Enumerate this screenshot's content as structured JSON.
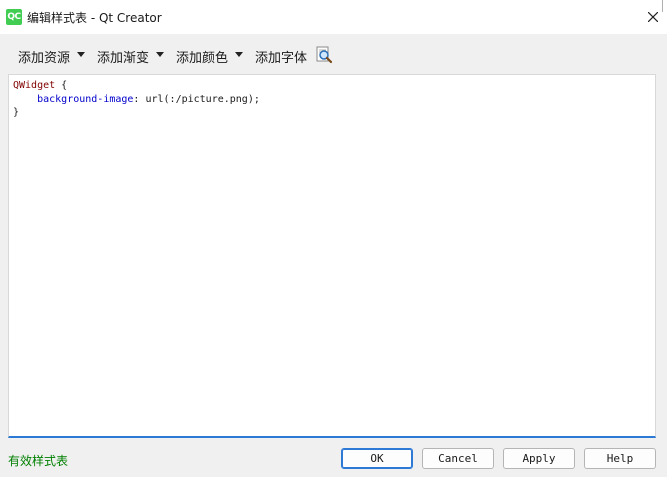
{
  "window": {
    "title": "编辑样式表 - Qt Creator",
    "app_icon_text": "QC"
  },
  "toolbar": {
    "add_resource": "添加资源",
    "add_gradient": "添加渐变",
    "add_color": "添加颜色",
    "add_font": "添加字体"
  },
  "editor": {
    "line1_selector": "QWidget",
    "line1_brace": " {",
    "line2_indent": "    ",
    "line2_property": "background-image",
    "line2_sep": ": ",
    "line2_value": "url(:/picture.png);",
    "line3_brace": "}"
  },
  "status": {
    "text": "有效样式表"
  },
  "buttons": {
    "ok": "OK",
    "cancel": "Cancel",
    "apply": "Apply",
    "help": "Help"
  },
  "colors": {
    "accent": "#2d7ad6",
    "status_valid": "#008000",
    "selector": "#800000",
    "property": "#0000cc",
    "qt_green": "#41cd52"
  }
}
